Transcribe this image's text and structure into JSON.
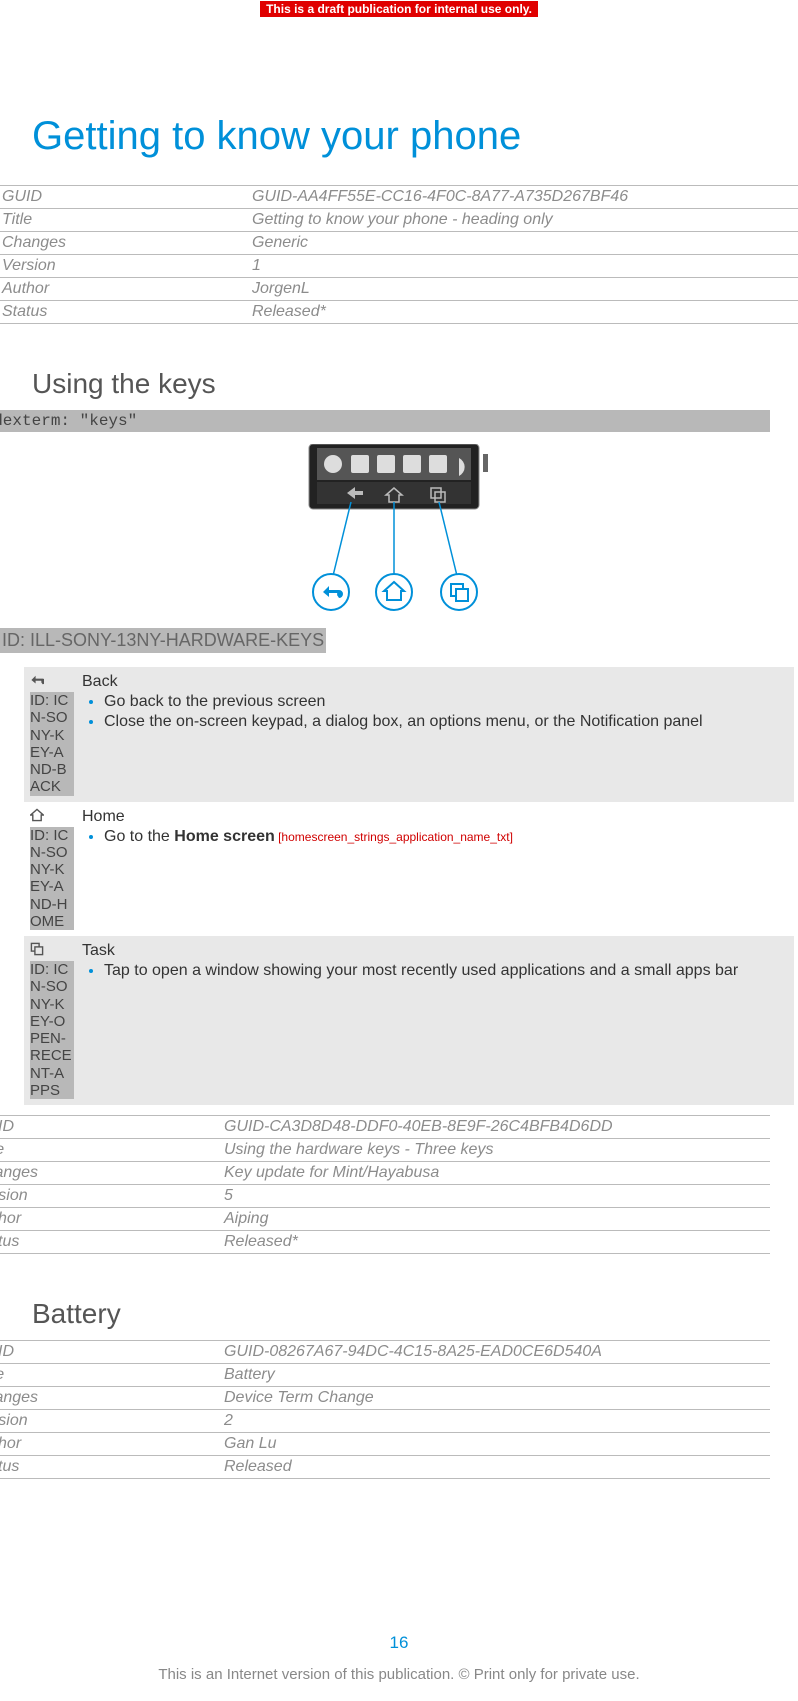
{
  "banner": "This is a draft publication for internal use only.",
  "title": "Getting to know your phone",
  "meta1": {
    "rows": [
      {
        "k": "GUID",
        "v": "GUID-AA4FF55E-CC16-4F0C-8A77-A735D267BF46"
      },
      {
        "k": "Title",
        "v": "Getting to know your phone - heading only"
      },
      {
        "k": "Changes",
        "v": "Generic"
      },
      {
        "k": "Version",
        "v": "1"
      },
      {
        "k": "Author",
        "v": "JorgenL"
      },
      {
        "k": "Status",
        "v": "Released*"
      }
    ]
  },
  "section_using_keys": "Using the keys",
  "indexterm": "Indexterm: \"keys\"",
  "illus_id": "ID: ILL-SONY-13NY-HARDWARE-KEYS",
  "keys": {
    "back": {
      "id_label": "ID: ICN-SONY-KEY-AND-BACK",
      "name": "Back",
      "bullets": [
        "Go back to the previous screen",
        "Close the on-screen keypad, a dialog box, an options menu, or the Notification panel"
      ]
    },
    "home": {
      "id_label": "ID: ICN-SONY-KEY-AND-HOME",
      "name": "Home",
      "bullet_prefix": "Go to the ",
      "bullet_bold": "Home screen",
      "annotation": " [homescreen_strings_application_name_txt]"
    },
    "task": {
      "id_label": "ID: ICN-SONY-KEY-OPEN-RECENT-APPS",
      "name": "Task",
      "bullets": [
        "Tap to open a window showing your most recently used applications and a small apps bar"
      ]
    }
  },
  "meta2": {
    "rows": [
      {
        "k": "GUID",
        "v": "GUID-CA3D8D48-DDF0-40EB-8E9F-26C4BFB4D6DD"
      },
      {
        "k": "Title",
        "v": "Using the hardware keys - Three keys"
      },
      {
        "k": "Changes",
        "v": "Key update for Mint/Hayabusa"
      },
      {
        "k": "Version",
        "v": "5"
      },
      {
        "k": "Author",
        "v": "Aiping"
      },
      {
        "k": "Status",
        "v": "Released*"
      }
    ]
  },
  "section_battery": "Battery",
  "meta3": {
    "rows": [
      {
        "k": "GUID",
        "v": "GUID-08267A67-94DC-4C15-8A25-EAD0CE6D540A"
      },
      {
        "k": "Title",
        "v": "Battery"
      },
      {
        "k": "Changes",
        "v": "Device Term Change"
      },
      {
        "k": "Version",
        "v": "2"
      },
      {
        "k": "Author",
        "v": "Gan Lu"
      },
      {
        "k": "Status",
        "v": "Released"
      }
    ]
  },
  "page_number": "16",
  "footer": "This is an Internet version of this publication. © Print only for private use."
}
